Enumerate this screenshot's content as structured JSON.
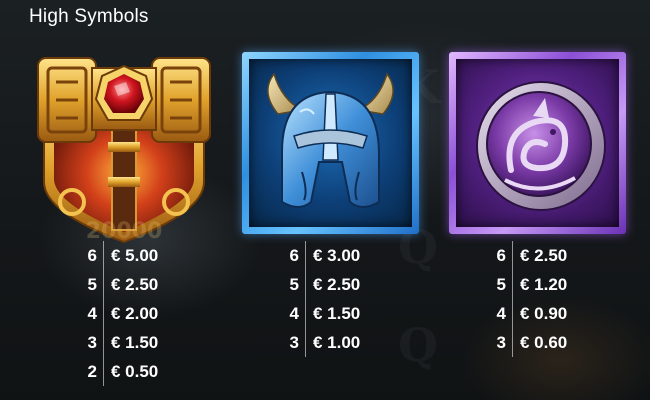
{
  "section_title": "High Symbols",
  "symbols": [
    {
      "id": "hammer",
      "icon": "golden-hammer-icon",
      "background_logo_text": "VALHALLA 20000",
      "payouts": [
        {
          "count": "6",
          "value": "€ 5.00"
        },
        {
          "count": "5",
          "value": "€ 2.50"
        },
        {
          "count": "4",
          "value": "€ 2.00"
        },
        {
          "count": "3",
          "value": "€ 1.50"
        },
        {
          "count": "2",
          "value": "€ 0.50"
        }
      ]
    },
    {
      "id": "helmet",
      "icon": "horned-helmet-icon",
      "frame_color": "#3f9ff0",
      "payouts": [
        {
          "count": "6",
          "value": "€ 3.00"
        },
        {
          "count": "5",
          "value": "€ 2.50"
        },
        {
          "count": "4",
          "value": "€ 1.50"
        },
        {
          "count": "3",
          "value": "€ 1.00"
        }
      ]
    },
    {
      "id": "shield",
      "icon": "dragon-shield-icon",
      "frame_color": "#9b5de5",
      "payouts": [
        {
          "count": "6",
          "value": "€ 2.50"
        },
        {
          "count": "5",
          "value": "€ 1.20"
        },
        {
          "count": "4",
          "value": "€ 0.90"
        },
        {
          "count": "3",
          "value": "€ 0.60"
        }
      ]
    }
  ]
}
